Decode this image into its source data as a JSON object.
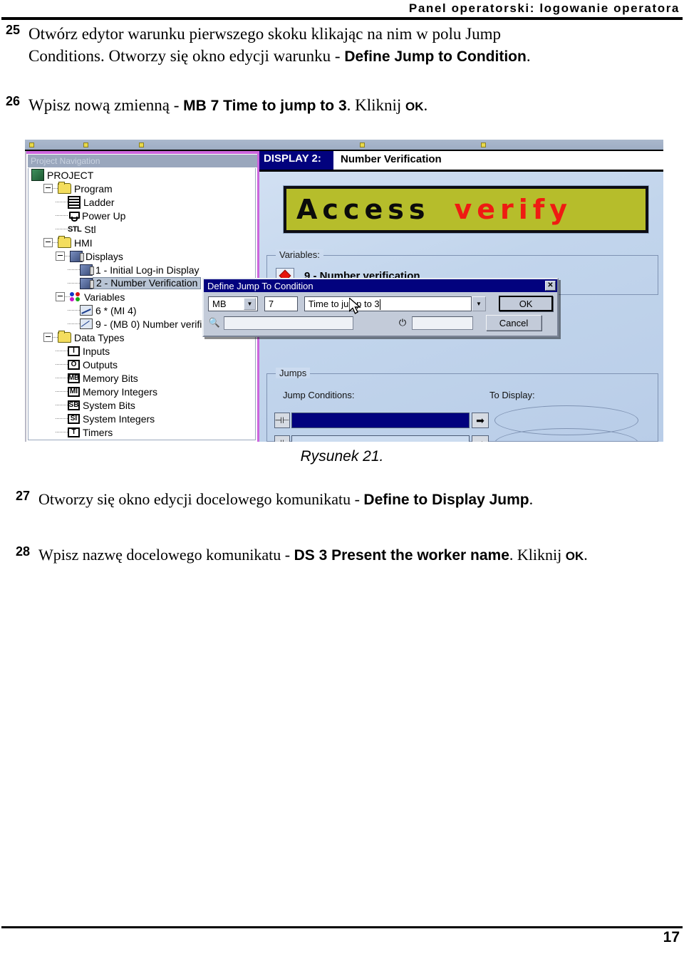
{
  "header": {
    "title": "Panel operatorski: logowanie operatora"
  },
  "steps": [
    {
      "num": "25",
      "parts": [
        {
          "t": "Otwórz edytor warunku pierwszego skoku klikając na nim w polu Jump Conditions. Otworzy się okno edycji warunku - ",
          "style": "normal"
        },
        {
          "t": "Define Jump to Condition",
          "style": "bold"
        },
        {
          "t": ".",
          "style": "normal"
        }
      ]
    },
    {
      "num": "26",
      "parts": [
        {
          "t": "Wpisz nową zmienną - ",
          "style": "normal"
        },
        {
          "t": "MB 7 Time to jump to 3",
          "style": "bold"
        },
        {
          "t": ". Kliknij ",
          "style": "normal"
        },
        {
          "t": "OK",
          "style": "bold-small"
        },
        {
          "t": ".",
          "style": "normal"
        }
      ]
    },
    {
      "num": "27",
      "parts": [
        {
          "t": "Otworzy się okno edycji docelowego komunikatu - ",
          "style": "normal"
        },
        {
          "t": "Define to Display Jump",
          "style": "bold"
        },
        {
          "t": ".",
          "style": "normal"
        }
      ]
    },
    {
      "num": "28",
      "parts": [
        {
          "t": "Wpisz nazwę docelowego komunikatu - ",
          "style": "normal"
        },
        {
          "t": "DS 3 Present the worker name",
          "style": "bold"
        },
        {
          "t": ". Kliknij ",
          "style": "normal"
        },
        {
          "t": "OK",
          "style": "bold-small"
        },
        {
          "t": ".",
          "style": "normal"
        }
      ]
    }
  ],
  "figure": {
    "caption": "Rysunek 21.",
    "nav": {
      "caption": "Project Navigation",
      "tree": [
        {
          "label": "PROJECT",
          "indent": 0,
          "icon": "project-icon",
          "expander": "none",
          "selected": false
        },
        {
          "label": "Program",
          "indent": 1,
          "icon": "folder-icon",
          "expander": "minus",
          "selected": false
        },
        {
          "label": "Ladder",
          "indent": 2,
          "icon": "ladder-icon",
          "expander": "none",
          "selected": false
        },
        {
          "label": "Power Up",
          "indent": 2,
          "icon": "power-up-icon",
          "expander": "none",
          "selected": false
        },
        {
          "label": "Stl",
          "indent": 2,
          "icon": "stl-icon",
          "expander": "none",
          "selected": false
        },
        {
          "label": "HMI",
          "indent": 1,
          "icon": "folder-icon",
          "expander": "minus",
          "selected": false
        },
        {
          "label": "Displays",
          "indent": 2,
          "icon": "display-icon",
          "expander": "minus",
          "selected": false
        },
        {
          "label": "1 - Initial Log-in Display",
          "indent": 3,
          "icon": "display-icon",
          "expander": "none",
          "selected": false
        },
        {
          "label": "2 - Number Verification",
          "indent": 3,
          "icon": "display-icon",
          "expander": "none",
          "selected": true
        },
        {
          "label": "Variables",
          "indent": 2,
          "icon": "variables-icon",
          "expander": "minus",
          "selected": false
        },
        {
          "label": "6 * (MI 4)",
          "indent": 3,
          "icon": "graph-variable-icon",
          "expander": "none",
          "selected": false
        },
        {
          "label": "9 - (MB 0)  Number verifi",
          "indent": 3,
          "icon": "bit-variable-icon",
          "expander": "none",
          "selected": false
        },
        {
          "label": "Data Types",
          "indent": 1,
          "icon": "folder-icon",
          "expander": "minus",
          "selected": false
        },
        {
          "label": "Inputs",
          "indent": 2,
          "icon": "inputs-icon",
          "expander": "none",
          "selected": false,
          "glyph": "I"
        },
        {
          "label": "Outputs",
          "indent": 2,
          "icon": "outputs-icon",
          "expander": "none",
          "selected": false,
          "glyph": "O"
        },
        {
          "label": "Memory Bits",
          "indent": 2,
          "icon": "memory-bits-icon",
          "expander": "none",
          "selected": false,
          "glyph": "MB"
        },
        {
          "label": "Memory Integers",
          "indent": 2,
          "icon": "memory-int-icon",
          "expander": "none",
          "selected": false,
          "glyph": "MI"
        },
        {
          "label": "System Bits",
          "indent": 2,
          "icon": "system-bits-icon",
          "expander": "none",
          "selected": false,
          "glyph": "SB"
        },
        {
          "label": "System Integers",
          "indent": 2,
          "icon": "system-int-icon",
          "expander": "none",
          "selected": false,
          "glyph": "SI"
        },
        {
          "label": "Timers",
          "indent": 2,
          "icon": "timers-icon",
          "expander": "none",
          "selected": false,
          "glyph": "T"
        }
      ]
    },
    "editor": {
      "display_tag": "DISPLAY 2:",
      "display_name": "Number Verification",
      "screen_text_black": "Access",
      "screen_text_red": "verify",
      "screen_bg_color": "#b6bd2b",
      "screen_red_color": "#ef1b12",
      "variables_group_label": "Variables:",
      "variable_row": "9 - Number verification",
      "jumps_group_label": "Jumps",
      "jump_conditions_label": "Jump Conditions:",
      "to_display_label": "To Display:",
      "contact_glyph": "⊣⊢",
      "arrow_glyph": "➡"
    },
    "dialog": {
      "title": "Define Jump To Condition",
      "close_glyph": "✕",
      "operand_type": "MB",
      "operand_address": "7",
      "operand_name": "Time to jump to 3",
      "ok_label": "OK",
      "cancel_label": "Cancel",
      "dropdown_glyph": "▼",
      "lookup_value": "",
      "secondary_value": "",
      "lookup_icon_glyph": "🔍",
      "power_icon_glyph": "⏻"
    }
  },
  "footer": {
    "page_number": "17"
  }
}
